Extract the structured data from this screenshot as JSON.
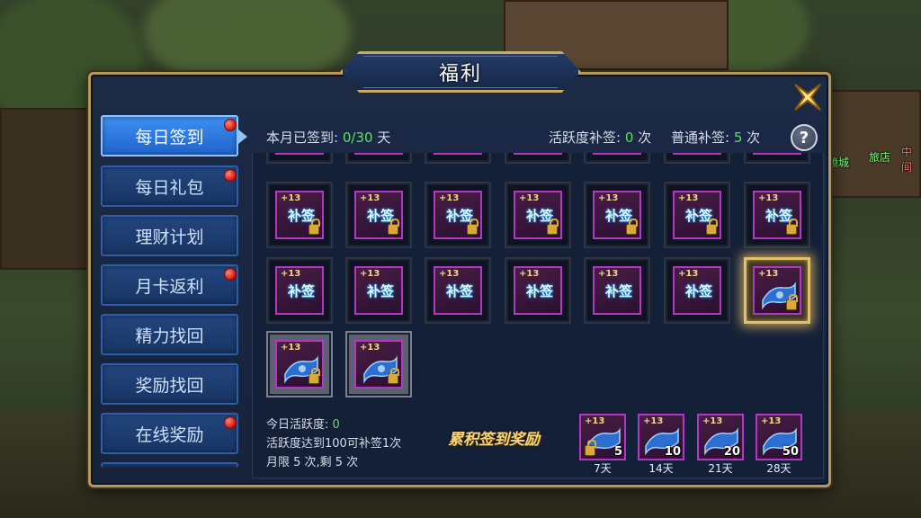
{
  "window": {
    "title": "福利"
  },
  "sidebar": {
    "items": [
      {
        "label": "每日签到",
        "active": true,
        "dot": true
      },
      {
        "label": "每日礼包",
        "active": false,
        "dot": true
      },
      {
        "label": "理财计划",
        "active": false,
        "dot": false
      },
      {
        "label": "月卡返利",
        "active": false,
        "dot": true
      },
      {
        "label": "精力找回",
        "active": false,
        "dot": false
      },
      {
        "label": "奖励找回",
        "active": false,
        "dot": false
      },
      {
        "label": "在线奖励",
        "active": false,
        "dot": true
      }
    ]
  },
  "status": {
    "signed_label": "本月已签到:",
    "signed_value": "0/30",
    "signed_unit": "天",
    "active_makeup_label": "活跃度补签:",
    "active_makeup_value": "0",
    "active_makeup_unit": "次",
    "normal_makeup_label": "普通补签:",
    "normal_makeup_value": "5",
    "normal_makeup_unit": "次"
  },
  "grid": {
    "plus_label": "+13",
    "makeup_label": "补签"
  },
  "bottom": {
    "today_active_label": "今日活跃度:",
    "today_active_value": "0",
    "rule_line": "活跃度达到100可补签1次",
    "month_limit": "月限 5 次,剩 5 次",
    "reward_title": "累积签到奖励",
    "rewards": [
      {
        "count": "5",
        "day": "7天"
      },
      {
        "count": "10",
        "day": "14天"
      },
      {
        "count": "20",
        "day": "21天"
      },
      {
        "count": "50",
        "day": "28天"
      }
    ]
  },
  "background": {
    "right_labels": [
      "赖城",
      "旅店",
      "中间"
    ]
  },
  "icons": {
    "close": "close-x-icon",
    "help": "help-question-icon",
    "lock": "lock-icon",
    "scroll": "scroll-icon"
  },
  "colors": {
    "accent_gold": "#c8aa60",
    "active_tab": "#2f7ae0",
    "notify_dot": "#d3120a",
    "value_green": "#5ee05e",
    "item_border": "#b137c4"
  }
}
